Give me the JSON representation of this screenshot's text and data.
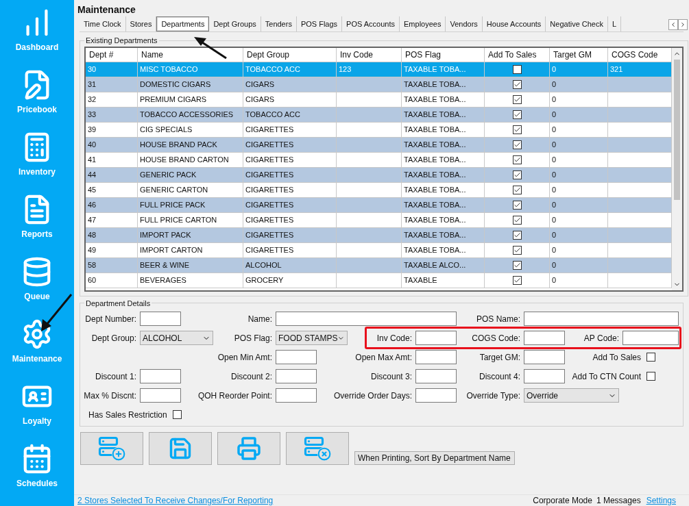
{
  "sidebar": {
    "items": [
      {
        "label": "Dashboard"
      },
      {
        "label": "Pricebook"
      },
      {
        "label": "Inventory"
      },
      {
        "label": "Reports"
      },
      {
        "label": "Queue"
      },
      {
        "label": "Maintenance"
      },
      {
        "label": "Loyalty"
      },
      {
        "label": "Schedules"
      }
    ]
  },
  "page_title": "Maintenance",
  "tabs": [
    {
      "label": "Time Clock",
      "selected": false
    },
    {
      "label": "Stores",
      "selected": false
    },
    {
      "label": "Departments",
      "selected": true
    },
    {
      "label": "Dept Groups",
      "selected": false
    },
    {
      "label": "Tenders",
      "selected": false
    },
    {
      "label": "POS Flags",
      "selected": false
    },
    {
      "label": "POS Accounts",
      "selected": false
    },
    {
      "label": "Employees",
      "selected": false
    },
    {
      "label": "Vendors",
      "selected": false
    },
    {
      "label": "House Accounts",
      "selected": false
    },
    {
      "label": "Negative Check",
      "selected": false
    },
    {
      "label": "L",
      "selected": false
    }
  ],
  "departments": {
    "title": "Existing Departments",
    "columns": [
      "Dept #",
      "Name",
      "Dept Group",
      "Inv Code",
      "POS Flag",
      "Add To Sales",
      "Target GM",
      "COGS Code"
    ],
    "rows": [
      {
        "dept": "30",
        "name": "MISC TOBACCO",
        "group": "TOBACCO ACC",
        "inv_code": "123",
        "pos_flag": "TAXABLE TOBA...",
        "add_to_sales": false,
        "target_gm": "0",
        "cogs_code": "321",
        "selected": true
      },
      {
        "dept": "31",
        "name": "DOMESTIC CIGARS",
        "group": "CIGARS",
        "inv_code": "",
        "pos_flag": "TAXABLE TOBA...",
        "add_to_sales": true,
        "target_gm": "0",
        "cogs_code": "",
        "selected": false
      },
      {
        "dept": "32",
        "name": "PREMIUM CIGARS",
        "group": "CIGARS",
        "inv_code": "",
        "pos_flag": "TAXABLE TOBA...",
        "add_to_sales": true,
        "target_gm": "0",
        "cogs_code": "",
        "selected": false
      },
      {
        "dept": "33",
        "name": "TOBACCO ACCESSORIES",
        "group": "TOBACCO ACC",
        "inv_code": "",
        "pos_flag": "TAXABLE TOBA...",
        "add_to_sales": true,
        "target_gm": "0",
        "cogs_code": "",
        "selected": false
      },
      {
        "dept": "39",
        "name": "CIG SPECIALS",
        "group": "CIGARETTES",
        "inv_code": "",
        "pos_flag": "TAXABLE TOBA...",
        "add_to_sales": true,
        "target_gm": "0",
        "cogs_code": "",
        "selected": false
      },
      {
        "dept": "40",
        "name": "HOUSE BRAND PACK",
        "group": "CIGARETTES",
        "inv_code": "",
        "pos_flag": "TAXABLE TOBA...",
        "add_to_sales": true,
        "target_gm": "0",
        "cogs_code": "",
        "selected": false
      },
      {
        "dept": "41",
        "name": "HOUSE BRAND CARTON",
        "group": "CIGARETTES",
        "inv_code": "",
        "pos_flag": "TAXABLE TOBA...",
        "add_to_sales": true,
        "target_gm": "0",
        "cogs_code": "",
        "selected": false
      },
      {
        "dept": "44",
        "name": "GENERIC PACK",
        "group": "CIGARETTES",
        "inv_code": "",
        "pos_flag": "TAXABLE TOBA...",
        "add_to_sales": true,
        "target_gm": "0",
        "cogs_code": "",
        "selected": false
      },
      {
        "dept": "45",
        "name": "GENERIC CARTON",
        "group": "CIGARETTES",
        "inv_code": "",
        "pos_flag": "TAXABLE TOBA...",
        "add_to_sales": true,
        "target_gm": "0",
        "cogs_code": "",
        "selected": false
      },
      {
        "dept": "46",
        "name": "FULL PRICE PACK",
        "group": "CIGARETTES",
        "inv_code": "",
        "pos_flag": "TAXABLE TOBA...",
        "add_to_sales": true,
        "target_gm": "0",
        "cogs_code": "",
        "selected": false
      },
      {
        "dept": "47",
        "name": "FULL PRICE CARTON",
        "group": "CIGARETTES",
        "inv_code": "",
        "pos_flag": "TAXABLE TOBA...",
        "add_to_sales": true,
        "target_gm": "0",
        "cogs_code": "",
        "selected": false
      },
      {
        "dept": "48",
        "name": "IMPORT PACK",
        "group": "CIGARETTES",
        "inv_code": "",
        "pos_flag": "TAXABLE TOBA...",
        "add_to_sales": true,
        "target_gm": "0",
        "cogs_code": "",
        "selected": false
      },
      {
        "dept": "49",
        "name": "IMPORT CARTON",
        "group": "CIGARETTES",
        "inv_code": "",
        "pos_flag": "TAXABLE TOBA...",
        "add_to_sales": true,
        "target_gm": "0",
        "cogs_code": "",
        "selected": false
      },
      {
        "dept": "58",
        "name": "BEER & WINE",
        "group": "ALCOHOL",
        "inv_code": "",
        "pos_flag": "TAXABLE ALCO...",
        "add_to_sales": true,
        "target_gm": "0",
        "cogs_code": "",
        "selected": false
      },
      {
        "dept": "60",
        "name": "BEVERAGES",
        "group": "GROCERY",
        "inv_code": "",
        "pos_flag": "TAXABLE",
        "add_to_sales": true,
        "target_gm": "0",
        "cogs_code": "",
        "selected": false
      }
    ]
  },
  "details": {
    "title": "Department Details",
    "fields": [
      {
        "kind": "text",
        "label": "Dept Number:"
      },
      {
        "kind": "text",
        "label": "Name:"
      },
      {
        "kind": "text",
        "label": "POS Name:"
      },
      {
        "kind": "select",
        "label": "Dept Group:",
        "value": "ALCOHOL"
      },
      {
        "kind": "select",
        "label": "POS Flag:",
        "value": "FOOD STAMPS"
      },
      {
        "kind": "text",
        "label": "Inv Code:"
      },
      {
        "kind": "text",
        "label": "COGS Code:"
      },
      {
        "kind": "text",
        "label": "AP Code:"
      },
      {
        "kind": "text",
        "label": "Open Min Amt:"
      },
      {
        "kind": "text",
        "label": "Open Max Amt:"
      },
      {
        "kind": "text",
        "label": "Target GM:"
      },
      {
        "kind": "check",
        "label": "Add To Sales",
        "checked": false
      },
      {
        "kind": "text",
        "label": "Discount 1:"
      },
      {
        "kind": "text",
        "label": "Discount 2:"
      },
      {
        "kind": "text",
        "label": "Discount 3:"
      },
      {
        "kind": "text",
        "label": "Discount 4:"
      },
      {
        "kind": "check",
        "label": "Add To CTN Count",
        "checked": false
      },
      {
        "kind": "text",
        "label": "Max % Discnt:"
      },
      {
        "kind": "text",
        "label": "QOH Reorder Point:"
      },
      {
        "kind": "text",
        "label": "Override Order Days:"
      },
      {
        "kind": "select",
        "label": "Override Type:",
        "value": "Override"
      },
      {
        "kind": "check",
        "label": "Has Sales Restriction",
        "checked": false
      }
    ]
  },
  "sort_select": {
    "value": "When Printing, Sort By Department Name"
  },
  "status_bar": {
    "stores_link": "2 Stores Selected To Receive Changes/For Reporting",
    "mode": "Corporate Mode",
    "messages": "1 Messages",
    "settings_link": "Settings"
  }
}
